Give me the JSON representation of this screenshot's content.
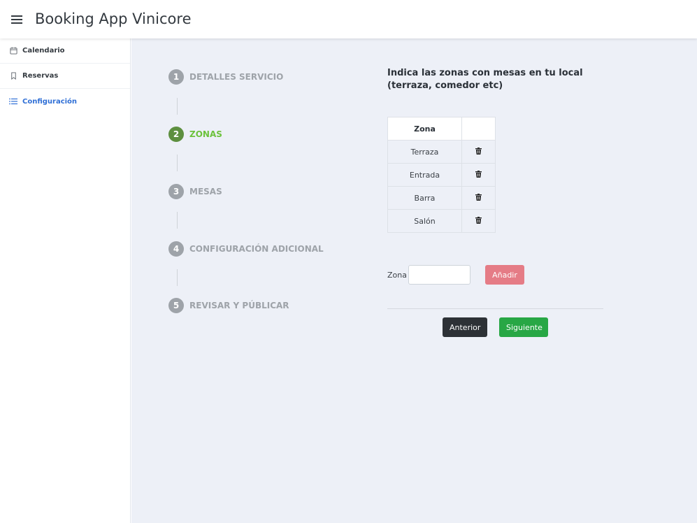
{
  "app": {
    "title": "Booking App Vinicore"
  },
  "sidebar": {
    "items": [
      {
        "label": "Calendario",
        "icon": "calendar-icon",
        "active": false
      },
      {
        "label": "Reservas",
        "icon": "bookmark-icon",
        "active": false
      },
      {
        "label": "Configuración",
        "icon": "list-icon",
        "active": true
      }
    ]
  },
  "steps": [
    {
      "number": "1",
      "label": "DETALLES SERVICIO",
      "active": false
    },
    {
      "number": "2",
      "label": "ZONAS",
      "active": true
    },
    {
      "number": "3",
      "label": "MESAS",
      "active": false
    },
    {
      "number": "4",
      "label": "CONFIGURACIÓN ADICIONAL",
      "active": false
    },
    {
      "number": "5",
      "label": "REVISAR Y PÚBLICAR",
      "active": false
    }
  ],
  "content": {
    "heading": "Indica las zonas con mesas en tu local (terraza, comedor etc)",
    "table": {
      "header": "Zona",
      "rows": [
        "Terraza",
        "Entrada",
        "Barra",
        "Salón"
      ]
    },
    "form": {
      "label": "Zona",
      "value": "",
      "add_label": "Añadir"
    },
    "buttons": {
      "prev_label": "Anterior",
      "next_label": "Siguiente"
    }
  },
  "colors": {
    "active_step_circle": "#5d8f3f",
    "active_step_text": "#6cc23c",
    "inactive_step": "#9ea3a9",
    "active_sidebar": "#2f6fd6",
    "add_button": "#e57c86",
    "next_button": "#28a745",
    "prev_button": "#2d3136",
    "main_background": "#edf0f7"
  }
}
